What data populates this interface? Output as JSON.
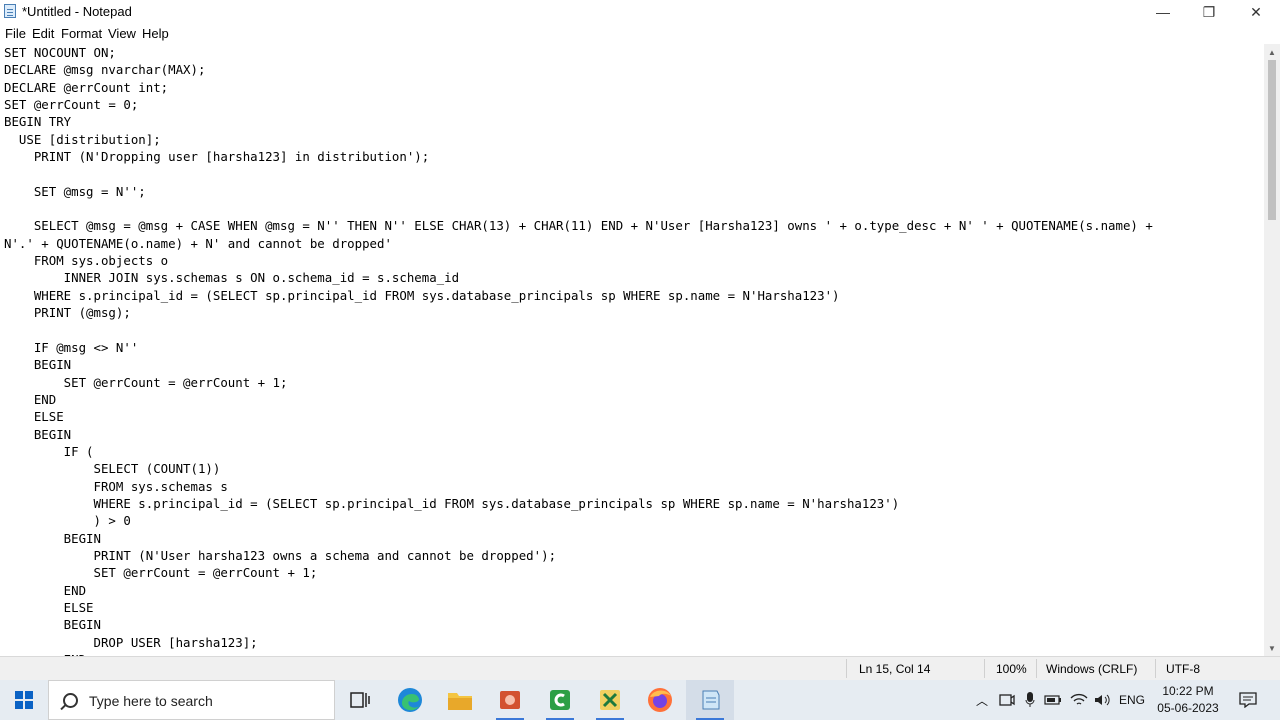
{
  "window": {
    "title": "*Untitled - Notepad",
    "minimize_glyph": "—",
    "restore_glyph": "❐",
    "close_glyph": "✕"
  },
  "menu": [
    "File",
    "Edit",
    "Format",
    "View",
    "Help"
  ],
  "editor": {
    "lines": [
      "SET NOCOUNT ON;",
      "DECLARE @msg nvarchar(MAX);",
      "DECLARE @errCount int;",
      "SET @errCount = 0;",
      "BEGIN TRY",
      "  USE [distribution];",
      "    PRINT (N'Dropping user [harsha123] in distribution');",
      "",
      "    SET @msg = N'';",
      "",
      "    SELECT @msg = @msg + CASE WHEN @msg = N'' THEN N'' ELSE CHAR(13) + CHAR(11) END + N'User [Harsha123] owns ' + o.type_desc + N' ' + QUOTENAME(s.name) +",
      "N'.' + QUOTENAME(o.name) + N' and cannot be dropped'",
      "    FROM sys.objects o",
      "        INNER JOIN sys.schemas s ON o.schema_id = s.schema_id",
      "    WHERE s.principal_id = (SELECT sp.principal_id FROM sys.database_principals sp WHERE sp.name = N'Harsha123')",
      "    PRINT (@msg);",
      "",
      "    IF @msg <> N''",
      "    BEGIN",
      "        SET @errCount = @errCount + 1;",
      "    END",
      "    ELSE",
      "    BEGIN",
      "        IF (",
      "            SELECT (COUNT(1))",
      "            FROM sys.schemas s",
      "            WHERE s.principal_id = (SELECT sp.principal_id FROM sys.database_principals sp WHERE sp.name = N'harsha123')",
      "            ) > 0",
      "        BEGIN",
      "            PRINT (N'User harsha123 owns a schema and cannot be dropped');",
      "            SET @errCount = @errCount + 1;",
      "        END",
      "        ELSE",
      "        BEGIN",
      "            DROP USER [harsha123];",
      "        END;"
    ]
  },
  "status": {
    "position": "Ln 15, Col 14",
    "zoom": "100%",
    "line_ending": "Windows (CRLF)",
    "encoding": "UTF-8"
  },
  "taskbar": {
    "search_placeholder": "Type here to search",
    "apps": [
      "task-view",
      "edge",
      "file-explorer",
      "powerpoint",
      "camtasia",
      "excel",
      "firefox",
      "notepad"
    ],
    "tray": {
      "language": "ENG",
      "time": "10:22 PM",
      "date": "05-06-2023"
    }
  },
  "colors": {
    "accent": "#0a62c4",
    "taskbar_bg": "#e6ecf2",
    "statusbar_bg": "#f0f0f0"
  }
}
